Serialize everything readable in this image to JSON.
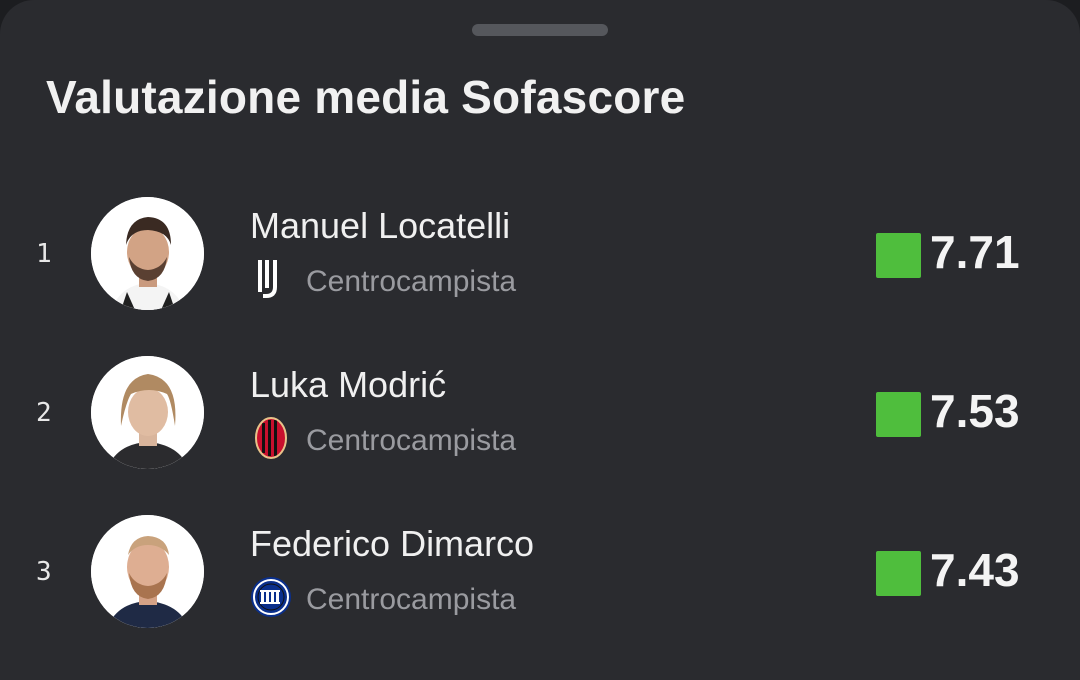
{
  "header": {
    "title": "Valutazione media Sofascore"
  },
  "players": [
    {
      "rank": "1",
      "name": "Manuel Locatelli",
      "position": "Centrocampista",
      "rating": "7.71",
      "club_icon": "juventus-crest-icon",
      "rating_color": "#4fbe3d"
    },
    {
      "rank": "2",
      "name": "Luka Modrić",
      "position": "Centrocampista",
      "rating": "7.53",
      "club_icon": "ac-milan-crest-icon",
      "rating_color": "#4fbe3d"
    },
    {
      "rank": "3",
      "name": "Federico Dimarco",
      "position": "Centrocampista",
      "rating": "7.43",
      "club_icon": "inter-crest-icon",
      "rating_color": "#4fbe3d"
    }
  ]
}
